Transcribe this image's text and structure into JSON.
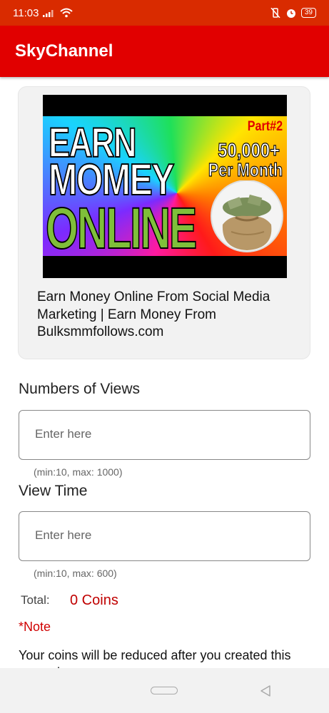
{
  "status_bar": {
    "time": "11:03",
    "battery": "39",
    "icons": [
      "signal-icon",
      "wifi-icon",
      "vibrate-icon",
      "alarm-icon",
      "battery-icon"
    ]
  },
  "app_bar": {
    "title": "SkyChannel"
  },
  "video_card": {
    "thumbnail": {
      "line1": "EARN",
      "line2": "MOMEY",
      "line3": "ONLINE",
      "part": "Part#2",
      "amount": "50,000+",
      "per_month": "Per Month"
    },
    "title": "Earn Money Online From Social Media Marketing | Earn Money From Bulksmmfollows.com"
  },
  "views": {
    "label": "Numbers of Views",
    "placeholder": "Enter here",
    "value": "",
    "hint": "(min:10, max: 1000)"
  },
  "view_time": {
    "label": "View Time",
    "placeholder": "Enter here",
    "value": "",
    "hint": "(min:10, max: 600)"
  },
  "total": {
    "label": "Total:",
    "value": "0 Coins"
  },
  "note": {
    "label": "*Note",
    "text": "Your coins will be reduced after you created this campaign"
  },
  "colors": {
    "status_bar": "#d92b00",
    "app_bar": "#e10000",
    "accent_red": "#c00000"
  },
  "nav_bar": {
    "icons": [
      "home-pill-icon",
      "back-triangle-icon"
    ]
  }
}
